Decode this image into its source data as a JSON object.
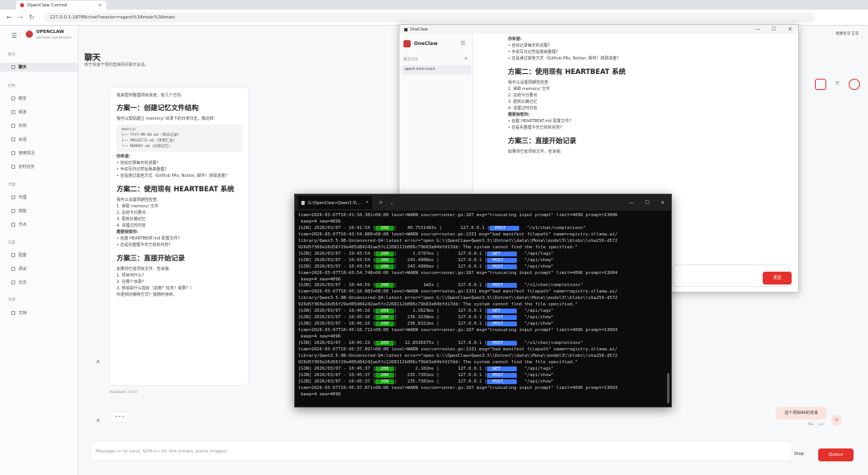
{
  "browser": {
    "tab_title": "OpenClaw Control",
    "url": "127.0.0.1:18789/chat?session=agent%3Amain%3Amain"
  },
  "brand": {
    "name": "OPENCLAW",
    "sub": "GATEWAY DASHBOARD"
  },
  "nav": {
    "sec_chat": "聊天",
    "chat": "聊天",
    "sec_ctrl": "控制",
    "ctrl": [
      "概览",
      "频道",
      "实例",
      "会话",
      "使用情况",
      "定时任务"
    ],
    "sec_agent": "代理",
    "agent": [
      "代理",
      "技能",
      "节点"
    ],
    "sec_set": "设置",
    "set": [
      "配置",
      "调试",
      "日志"
    ],
    "sec_res": "资源",
    "res": [
      "文档"
    ]
  },
  "header": {
    "title": "聊天",
    "subtitle": "用于快速干预的直接网关聊天会话。",
    "right_text": "健康状况 正常"
  },
  "msg": {
    "intro": "我来帮你整理项目进度，有几个方向:",
    "h1": "方案一：创建记忆文件结构",
    "p1": "我可以帮助建立 memory/ 目录下的日常日志，像这样:",
    "code": [
      "memory/",
      "├── YYYY-MM-DD.md (每日记录)",
      "├── PROJECTS.md (项目汇总)",
      "└── MEMORY.md (长期记忆)"
    ],
    "need": "你希望:",
    "l1": [
      "自动记录每天的进展?",
      "手动写日记然后我来整理?",
      "还是通过其他方式（GitHub PRs, Notion, 邮件）获取进度?"
    ],
    "h2": "方案二：使用现有 HEARTBEAT 系统",
    "p2": "我可以设置周期性检查:",
    "l2": [
      "1. 读取 memory/ 文件",
      "2. 总结今日要点",
      "3. 更新长期记忆",
      "4. 清理过时内容"
    ],
    "conf": "需要我帮你:",
    "l3": [
      "创建 HEARTBEAT.md 配置文件?",
      "还是先整理今天已有的内容?"
    ],
    "h3": "方案三：直接开始记录",
    "p3": "如果你已有项目文件，告诉我:",
    "l4": [
      "1. 项目叫什么?",
      "2. 在哪个目录?",
      "3. 想追踪什么指标（进度？任务？成果？）"
    ],
    "end": "你更倾向哪种方式？我随时待命。",
    "avatar": "A",
    "author": "Assistant",
    "time": "10m5"
  },
  "typing": {
    "avatar": "A",
    "dots": "• • •"
  },
  "user": {
    "text": "这个项目RA的未来",
    "label": "You",
    "time": "Just",
    "avatar": "U"
  },
  "composer": {
    "placeholder": "Message (↩ to send, Shift+↩ for line breaks, paste images)",
    "stop": "Stop",
    "queue": "Queue"
  },
  "oc": {
    "title": "OneClaw",
    "app": "OneClaw",
    "sidebar_label": "最近对话",
    "session": "agent:main:main",
    "partial": "你希望:",
    "l1": [
      "自动记录每天的进展?",
      "手动写日记然后我来整理?",
      "还是通过其他方式（GitHub PRs, Notion, 邮件）获取进度?"
    ],
    "h2": "方案二：使用现有 HEARTBEAT 系统",
    "p2": "我可以设置周期性检查:",
    "l2": [
      "1. 读取 memory/ 文件",
      "2. 总结今日要点",
      "3. 更新长期记忆",
      "4. 清理过时内容"
    ],
    "conf": "需要我帮你:",
    "l3": [
      "创建 HEARTBEAT.md 配置文件?",
      "还是先整理今天已有的内容?"
    ],
    "h3": "方案三：直接开始记录",
    "p3": "如果你已有项目文件，告诉我:",
    "send": "发送"
  },
  "term": {
    "title": "G:\\OpenClaw>Qwen3.5\\...  - 复制",
    "lines": [
      "time=2026-03-07T10:41:34.381+08:00 level=WARN source=runner.go:187 msg=\"truncating input prompt\" limit=4096 prompt=13006",
      " keep=4 new=4096",
      "[GIN] 2026/03/07 - 10:41:54 |[200]|    40.7531465s |       127.0.0.1 |[POST ]   \"/v1/chat/completions\"",
      "time=2026-03-07T10:43:54.880+08:00 level=WARN source=routes.go:1331 msg=\"bad manifest filepath\" name=registry.ollama.ai/",
      "library/Qwen3.5-9B-Uncensored-Q4:latest error=\"open G:\\\\OpenClaw+Qwen3.5\\\\Dotnet\\\\data\\\\Mona\\\\model3\\\\blobs\\\\sha256-d572",
      "926d5f360a16d56f29e405d84242ae5fc2268112b006c79b63e04bfd17dd: The system cannot find the file specified.\"",
      "[GIN] 2026/03/07 - 10:43:54 |[200]|      1.5707ms |       127.0.0.1 |[GET  ]   \"/api/tags\"",
      "[GIN] 2026/03/07 - 10:43:54 |[200]|    243.4986ms |       127.0.0.1 |[POST ]   \"/api/show\"",
      "[GIN] 2026/03/07 - 10:43:54 |[200]|    243.4986ms |       127.0.0.1 |[POST ]   \"/api/show\"",
      "time=2026-03-07T10:43:54.748+08:00 level=WARN source=runner.go:187 msg=\"truncating input prompt\" limit=4096 prompt=13004",
      " keep=4 new=4096",
      "[GIN] 2026/03/07 - 10:44:59 |[200]|          1m5s |       127.0.0.1 |[POST ]   \"/v1/chat/completions\"",
      "time=2026-03-07T10:45:10.083+08:00 level=WARN source=routes.go:1331 msg=\"bad manifest filepath\" name=registry.ollama.ai/",
      "library/Qwen3.5-9B-Uncensored-Q4:latest error=\"open G:\\\\OpenClaw+Qwen3.5\\\\Dotnet\\\\data\\\\Mona\\\\model3\\\\blobs\\\\sha256-d572",
      "926d5f360a16d56f29e405d84242ae5fc2268112b006c79b63e04bfd17dd: The system cannot find the file specified.\"",
      "[GIN] 2026/03/07 - 10:45:10 |[200]|      1.5623ms |       127.0.0.1 |[GET  ]   \"/api/tags\"",
      "[GIN] 2026/03/07 - 10:45:10 |[200]|    236.3238ms |       127.0.0.1 |[POST ]   \"/api/show\"",
      "[GIN] 2026/03/07 - 10:45:10 |[200]|    236.8322ms |       127.0.0.1 |[POST ]   \"/api/show\"",
      "time=2026-03-07T10:45:10.712+08:00 level=WARN source=runner.go:187 msg=\"truncating input prompt\" limit=4096 prompt=13003",
      " keep=4 new=4096",
      "[GIN] 2026/03/07 - 10:45:23 |[200]|   12.8536975s |       127.0.0.1 |[POST ]   \"/v1/chat/completions\"",
      "time=2026-03-07T10:45:37.897+08:00 level=WARN source=routes.go:1331 msg=\"bad manifest filepath\" name=registry.ollama.ai/",
      "library/Qwen3.5-9B-Uncensored-Q4:latest error=\"open G:\\\\OpenClaw+Qwen3.5\\\\Dotnet\\\\data\\\\Mona\\\\model3\\\\blobs\\\\sha256-d572",
      "926d5f360a16d56f29e405d84242ae5fc2268112b006c79b63e04bfd17dd: The system cannot find the file specified.\"",
      "[GIN] 2026/03/07 - 10:45:37 |[200]|       2.102ms |       127.0.0.1 |[GET  ]   \"/api/tags\"",
      "[GIN] 2026/03/07 - 10:45:37 |[200]|    235.7301ms |       127.0.0.1 |[POST ]   \"/api/show\"",
      "[GIN] 2026/03/07 - 10:45:37 |[200]|    235.7301ms |       127.0.0.1 |[POST ]   \"/api/show\"",
      "time=2026-03-07T10:45:37.871+08:00 level=WARN source=runner.go:187 msg=\"truncating input prompt\" limit=4096 prompt=13003",
      " keep=4 new=4096",
      ""
    ]
  },
  "colors": {
    "accent": "#e5322d",
    "term_bg": "#0c0c0c",
    "status_green": "#13a10e",
    "method_blue": "#3b78ff"
  }
}
